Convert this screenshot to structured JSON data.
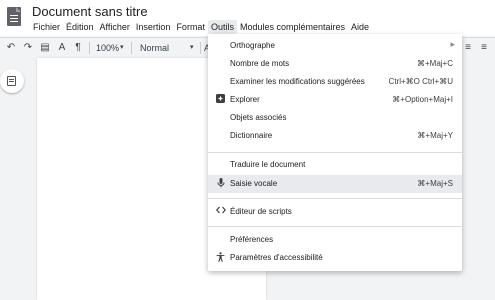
{
  "header": {
    "title": "Document sans titre",
    "menus": [
      "Fichier",
      "Édition",
      "Afficher",
      "Insertion",
      "Format",
      "Outils",
      "Modules complémentaires",
      "Aide"
    ],
    "active_menu": "Outils"
  },
  "toolbar": {
    "zoom": "100%",
    "style": "Normal",
    "font_initial": "A"
  },
  "tools_menu": {
    "items": [
      {
        "label": "Orthographe",
        "shortcut": "",
        "submenu": true,
        "icon": ""
      },
      {
        "label": "Nombre de mots",
        "shortcut": "⌘+Maj+C",
        "icon": ""
      },
      {
        "label": "Examiner les modifications suggérées",
        "shortcut": "Ctrl+⌘O Ctrl+⌘U",
        "icon": ""
      },
      {
        "label": "Explorer",
        "shortcut": "⌘+Option+Maj+I",
        "icon": "explore-icon"
      },
      {
        "label": "Objets associés",
        "shortcut": "",
        "icon": ""
      },
      {
        "label": "Dictionnaire",
        "shortcut": "⌘+Maj+Y",
        "icon": ""
      },
      {
        "label": "Traduire le document",
        "shortcut": "",
        "icon": ""
      },
      {
        "label": "Saisie vocale",
        "shortcut": "⌘+Maj+S",
        "icon": "microphone-icon",
        "highlighted": true
      },
      {
        "label": "Éditeur de scripts",
        "shortcut": "",
        "icon": "code-icon"
      },
      {
        "label": "Préférences",
        "shortcut": "",
        "icon": ""
      },
      {
        "label": "Paramètres d'accessibilité",
        "shortcut": "",
        "icon": "accessibility-icon"
      }
    ]
  },
  "colors": {
    "menu_highlight": "#e8eaed",
    "background": "#f1f3f4",
    "page": "#ffffff"
  }
}
